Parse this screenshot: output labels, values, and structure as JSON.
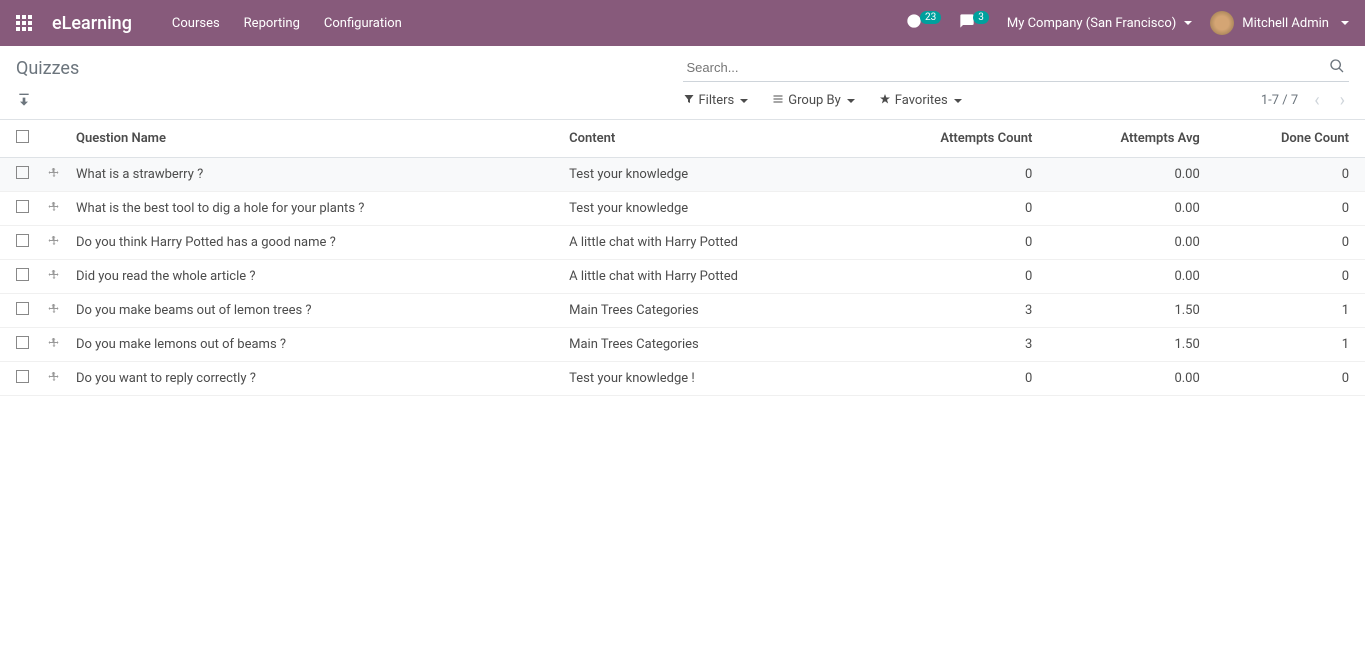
{
  "navbar": {
    "brand": "eLearning",
    "links": [
      "Courses",
      "Reporting",
      "Configuration"
    ],
    "activity_count": "23",
    "messages_count": "3",
    "company": "My Company (San Francisco)",
    "user": "Mitchell Admin"
  },
  "breadcrumb": "Quizzes",
  "search": {
    "placeholder": "Search...",
    "filters_label": "Filters",
    "groupby_label": "Group By",
    "favorites_label": "Favorites"
  },
  "pager": "1-7 / 7",
  "table": {
    "headers": {
      "name": "Question Name",
      "content": "Content",
      "attempts_count": "Attempts Count",
      "attempts_avg": "Attempts Avg",
      "done_count": "Done Count"
    },
    "rows": [
      {
        "name": "What is a strawberry ?",
        "content": "Test your knowledge",
        "attempts_count": "0",
        "attempts_avg": "0.00",
        "done_count": "0"
      },
      {
        "name": "What is the best tool to dig a hole for your plants ?",
        "content": "Test your knowledge",
        "attempts_count": "0",
        "attempts_avg": "0.00",
        "done_count": "0"
      },
      {
        "name": "Do you think Harry Potted has a good name ?",
        "content": "A little chat with Harry Potted",
        "attempts_count": "0",
        "attempts_avg": "0.00",
        "done_count": "0"
      },
      {
        "name": "Did you read the whole article ?",
        "content": "A little chat with Harry Potted",
        "attempts_count": "0",
        "attempts_avg": "0.00",
        "done_count": "0"
      },
      {
        "name": "Do you make beams out of lemon trees ?",
        "content": "Main Trees Categories",
        "attempts_count": "3",
        "attempts_avg": "1.50",
        "done_count": "1"
      },
      {
        "name": "Do you make lemons out of beams ?",
        "content": "Main Trees Categories",
        "attempts_count": "3",
        "attempts_avg": "1.50",
        "done_count": "1"
      },
      {
        "name": "Do you want to reply correctly ?",
        "content": "Test your knowledge !",
        "attempts_count": "0",
        "attempts_avg": "0.00",
        "done_count": "0"
      }
    ]
  }
}
